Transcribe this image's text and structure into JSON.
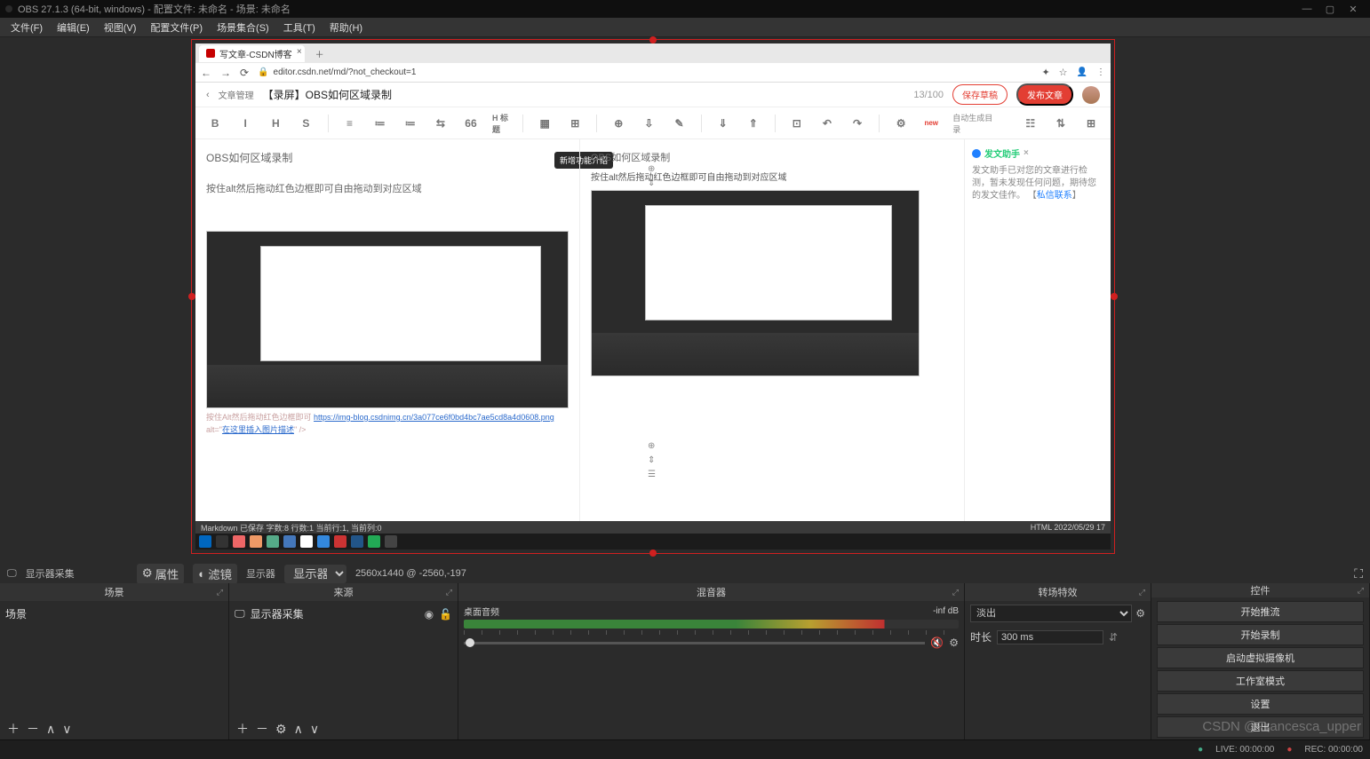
{
  "window": {
    "title": "OBS 27.1.3 (64-bit, windows) - 配置文件: 未命名 - 场景: 未命名",
    "min": "—",
    "max": "▢",
    "close": "✕"
  },
  "menu": [
    "文件(F)",
    "编辑(E)",
    "视图(V)",
    "配置文件(P)",
    "场景集合(S)",
    "工具(T)",
    "帮助(H)"
  ],
  "browser": {
    "tab_title": "写文章-CSDN博客",
    "plus": "＋",
    "back": "←",
    "fwd": "→",
    "reload": "⟳",
    "lock": "🔒",
    "url": "editor.csdn.net/md/?not_checkout=1",
    "ext": "✦",
    "star": "☆",
    "user": "👤",
    "more": "⋮"
  },
  "editor": {
    "back": "‹",
    "crumb": "文章管理",
    "title": "【录屏】OBS如何区域录制",
    "count": "13/100",
    "save_draft": "保存草稿",
    "publish": "发布文章",
    "toolbar_labels": [
      "B",
      "I",
      "H",
      "S",
      "",
      "≡",
      "≔",
      "≔",
      "⇆",
      "66",
      "H 标题",
      "",
      "▦",
      "⊞",
      "",
      "⊕",
      "⇩",
      "✎",
      "",
      "⇓",
      "⇑",
      "",
      "⊡",
      "↶",
      "↷",
      "",
      "⚙",
      "new",
      "自动生成目录"
    ],
    "tooltip": "新增功能介绍",
    "left_h1": "OBS如何区域录制",
    "left_p": "按住alt然后拖动红色边框即可自由拖动到对应区域",
    "right_h1": "OBS如何区域录制",
    "right_p": "按住alt然后拖动红色边框即可自由拖动到对应区域",
    "status_l": "Markdown 已保存  字数:8  行数:1  当前行:1, 当前列:0",
    "status_r": "HTML  2022/05/29 17",
    "assist_title": "发文助手",
    "assist_msg": "发文助手已对您的文章进行检测，暂未发现任何问题，期待您的发文佳作。",
    "assist_link": "私信联系"
  },
  "html_snip": {
    "a": "按住Alt然后拖动红色边框即可",
    "b": "https://img-blog.csdnimg.cn/3a077ce6f0bd4bc7ae5cd8a4d0608.png",
    "c": "alt=\"",
    "d": "在这里插入图片描述",
    "e": "\" />"
  },
  "infobar": {
    "display_capture": "显示器采集",
    "props": "属性",
    "filters": "滤镜",
    "display_label": "显示器",
    "display_sel": "显示器",
    "res": "2560x1440 @ -2560,-197",
    "fit": "⛶"
  },
  "panels": {
    "scenes": {
      "title": "场景",
      "item": "场景"
    },
    "sources": {
      "title": "来源",
      "item": "显示器采集"
    },
    "mixer": {
      "title": "混音器",
      "desktop": "桌面音频",
      "db": "-inf dB"
    },
    "trans": {
      "title": "转场特效",
      "sel": "淡出",
      "dur_label": "时长",
      "dur_val": "300 ms"
    },
    "ctrl": {
      "title": "控件",
      "buttons": [
        "开始推流",
        "开始录制",
        "启动虚拟摄像机",
        "工作室模式",
        "设置",
        "退出"
      ]
    },
    "foot": {
      "add": "＋",
      "del": "－",
      "up": "∧",
      "dn": "∨",
      "gear": "⚙"
    }
  },
  "status": {
    "live_dot": "●",
    "live": "LIVE: 00:00:00",
    "rec_dot": "●",
    "rec": "REC: 00:00:00",
    "watermark": "CSDN @Francesca_upper"
  }
}
